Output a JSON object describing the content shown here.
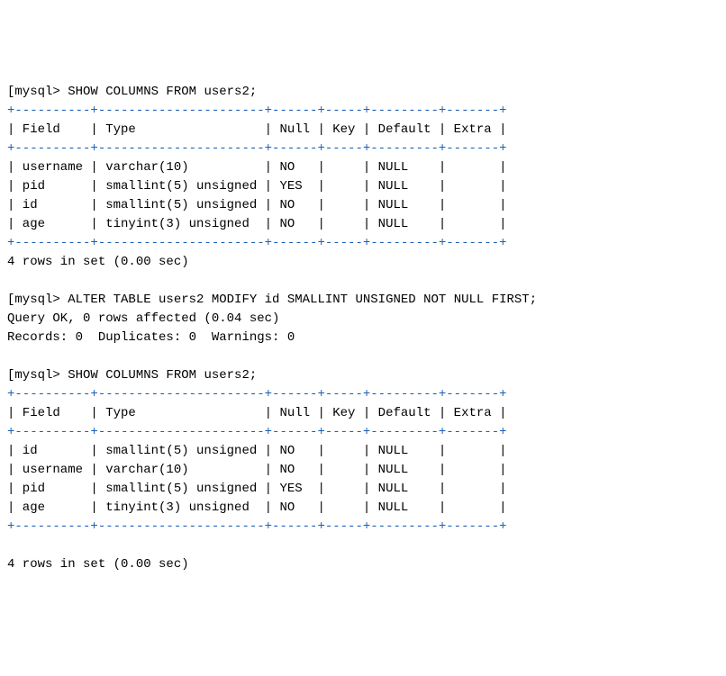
{
  "prompt": "mysql> ",
  "cmd1": "SHOW COLUMNS FROM users2;",
  "table1": {
    "headers": {
      "field": "Field",
      "type": "Type",
      "null": "Null",
      "key": "Key",
      "default": "Default",
      "extra": "Extra"
    },
    "rows": [
      {
        "field": "username",
        "type": "varchar(10)",
        "null": "NO",
        "key": "",
        "default": "NULL",
        "extra": ""
      },
      {
        "field": "pid",
        "type": "smallint(5) unsigned",
        "null": "YES",
        "key": "",
        "default": "NULL",
        "extra": ""
      },
      {
        "field": "id",
        "type": "smallint(5) unsigned",
        "null": "NO",
        "key": "",
        "default": "NULL",
        "extra": ""
      },
      {
        "field": "age",
        "type": "tinyint(3) unsigned",
        "null": "NO",
        "key": "",
        "default": "NULL",
        "extra": ""
      }
    ],
    "footer": "4 rows in set (0.00 sec)"
  },
  "cmd2": "ALTER TABLE users2 MODIFY id SMALLINT UNSIGNED NOT NULL FIRST;",
  "cmd2_result1": "Query OK, 0 rows affected (0.04 sec)",
  "cmd2_result2": "Records: 0  Duplicates: 0  Warnings: 0",
  "cmd3": "SHOW COLUMNS FROM users2;",
  "table2": {
    "headers": {
      "field": "Field",
      "type": "Type",
      "null": "Null",
      "key": "Key",
      "default": "Default",
      "extra": "Extra"
    },
    "rows": [
      {
        "field": "id",
        "type": "smallint(5) unsigned",
        "null": "NO",
        "key": "",
        "default": "NULL",
        "extra": ""
      },
      {
        "field": "username",
        "type": "varchar(10)",
        "null": "NO",
        "key": "",
        "default": "NULL",
        "extra": ""
      },
      {
        "field": "pid",
        "type": "smallint(5) unsigned",
        "null": "YES",
        "key": "",
        "default": "NULL",
        "extra": ""
      },
      {
        "field": "age",
        "type": "tinyint(3) unsigned",
        "null": "NO",
        "key": "",
        "default": "NULL",
        "extra": ""
      }
    ],
    "footer": "4 rows in set (0.00 sec)"
  },
  "sep": "+----------+----------------------+------+-----+---------+-------+",
  "chart_data": {
    "type": "table",
    "tables": [
      {
        "title": "SHOW COLUMNS FROM users2 (before)",
        "columns": [
          "Field",
          "Type",
          "Null",
          "Key",
          "Default",
          "Extra"
        ],
        "rows": [
          [
            "username",
            "varchar(10)",
            "NO",
            "",
            "NULL",
            ""
          ],
          [
            "pid",
            "smallint(5) unsigned",
            "YES",
            "",
            "NULL",
            ""
          ],
          [
            "id",
            "smallint(5) unsigned",
            "NO",
            "",
            "NULL",
            ""
          ],
          [
            "age",
            "tinyint(3) unsigned",
            "NO",
            "",
            "NULL",
            ""
          ]
        ]
      },
      {
        "title": "SHOW COLUMNS FROM users2 (after)",
        "columns": [
          "Field",
          "Type",
          "Null",
          "Key",
          "Default",
          "Extra"
        ],
        "rows": [
          [
            "id",
            "smallint(5) unsigned",
            "NO",
            "",
            "NULL",
            ""
          ],
          [
            "username",
            "varchar(10)",
            "NO",
            "",
            "NULL",
            ""
          ],
          [
            "pid",
            "smallint(5) unsigned",
            "YES",
            "",
            "NULL",
            ""
          ],
          [
            "age",
            "tinyint(3) unsigned",
            "NO",
            "",
            "NULL",
            ""
          ]
        ]
      }
    ]
  }
}
